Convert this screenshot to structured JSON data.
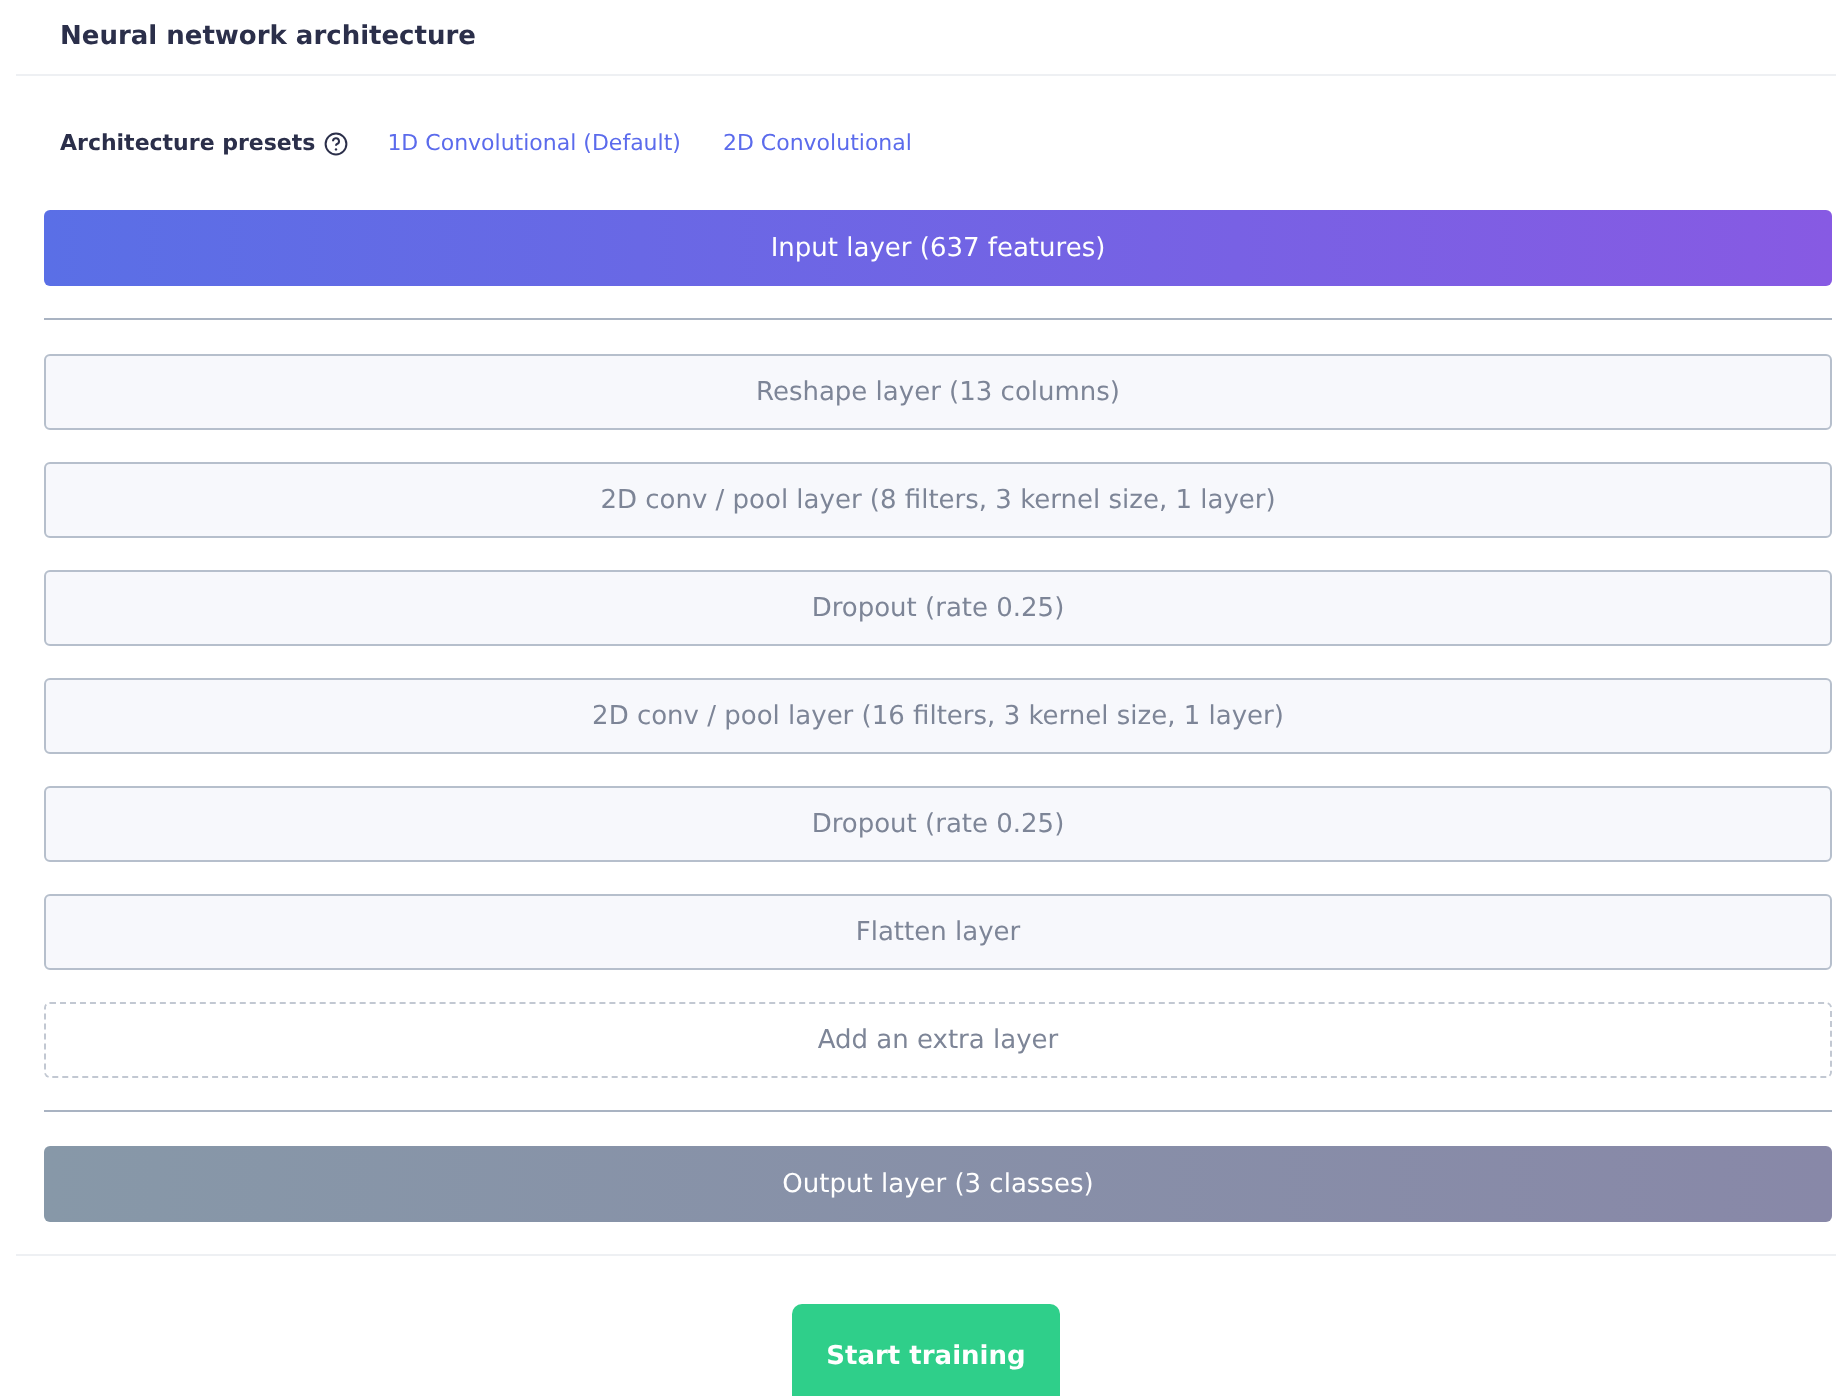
{
  "panel": {
    "title": "Neural network architecture"
  },
  "presets": {
    "label": "Architecture presets",
    "options": [
      "1D Convolutional (Default)",
      "2D Convolutional"
    ]
  },
  "input_layer": {
    "label": "Input layer (637 features)"
  },
  "layers": [
    {
      "kind": "layer",
      "label": "Reshape layer (13 columns)"
    },
    {
      "kind": "layer",
      "label": "2D conv / pool layer (8 filters, 3 kernel size, 1 layer)"
    },
    {
      "kind": "layer",
      "label": "Dropout (rate 0.25)"
    },
    {
      "kind": "layer",
      "label": "2D conv / pool layer (16 filters, 3 kernel size, 1 layer)"
    },
    {
      "kind": "layer",
      "label": "Dropout (rate 0.25)"
    },
    {
      "kind": "layer",
      "label": "Flatten layer"
    },
    {
      "kind": "add",
      "label": "Add an extra layer"
    }
  ],
  "output_layer": {
    "label": "Output layer (3 classes)"
  },
  "start_button": {
    "label": "Start training"
  }
}
